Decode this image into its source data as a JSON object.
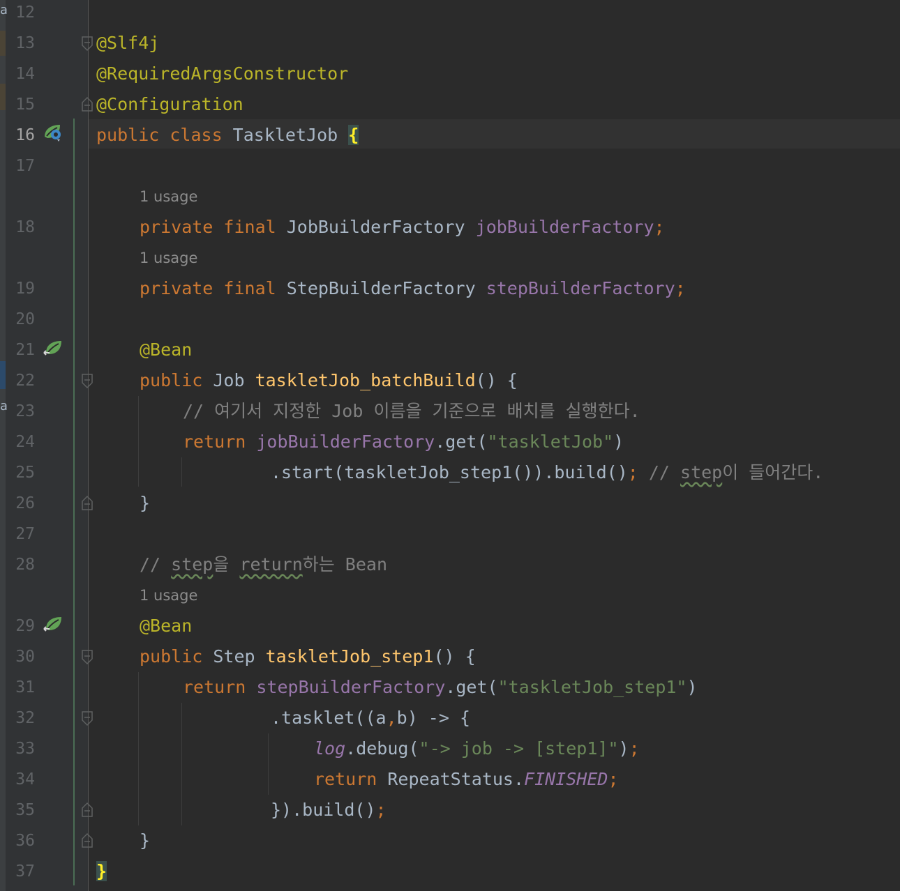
{
  "editor": {
    "line_numbers": [
      "12",
      "13",
      "14",
      "15",
      "16",
      "17",
      "18",
      "19",
      "20",
      "21",
      "22",
      "23",
      "24",
      "25",
      "26",
      "27",
      "28",
      "29",
      "30",
      "31",
      "32",
      "33",
      "34",
      "35",
      "36",
      "37"
    ],
    "usage_hint": "1 usage",
    "left_fragments": [
      "a",
      "a"
    ],
    "lines": {
      "l13": "@Slf4j",
      "l14": "@RequiredArgsConstructor",
      "l15": "@Configuration",
      "l16_kw": "public class ",
      "l16_name": "TaskletJob ",
      "l16_brace": "{",
      "l18_kw": "private final ",
      "l18_type": "JobBuilderFactory ",
      "l18_field": "jobBuilderFactory",
      "l18_semi": ";",
      "l19_kw": "private final ",
      "l19_type": "StepBuilderFactory ",
      "l19_field": "stepBuilderFactory",
      "l19_semi": ";",
      "l21": "@Bean",
      "l22_kw": "public ",
      "l22_type": "Job ",
      "l22_method": "taskletJob_batchBuild",
      "l22_rest": "() {",
      "l23": "// 여기서 지정한 Job 이름을 기준으로 배치를 실행한다.",
      "l24_kw": "return ",
      "l24_field": "jobBuilderFactory",
      "l24_call": ".get(",
      "l24_str": "\"taskletJob\"",
      "l24_close": ")",
      "l25_code": ".start(taskletJob_step1()).build()",
      "l25_semi": "; ",
      "l25_cmt_pre": "// ",
      "l25_cmt_wavy": "step",
      "l25_cmt_rest": "이 들어간다.",
      "l26": "}",
      "l28_pre": "// ",
      "l28_w1": "step",
      "l28_mid": "을 ",
      "l28_w2": "return",
      "l28_rest": "하는 Bean",
      "l29": "@Bean",
      "l30_kw": "public ",
      "l30_type": "Step ",
      "l30_method": "taskletJob_step1",
      "l30_rest": "() {",
      "l31_kw": "return ",
      "l31_field": "stepBuilderFactory",
      "l31_call": ".get(",
      "l31_str": "\"taskletJob_step1\"",
      "l31_close": ")",
      "l32_a": ".tasklet((a",
      "l32_comma": ",",
      "l32_b": "b) -> {",
      "l33_log": "log",
      "l33_call": ".debug(",
      "l33_str": "\"-> job -> [step1]\"",
      "l33_close": ")",
      "l33_semi": ";",
      "l34_kw": "return ",
      "l34_type": "RepeatStatus.",
      "l34_const": "FINISHED",
      "l34_semi": ";",
      "l35_code": "}).build()",
      "l35_semi": ";",
      "l36": "}",
      "l37": "}"
    }
  },
  "colors": {
    "background": "#2b2b2b",
    "gutter": "#313335",
    "keyword": "#cc7832",
    "annotation": "#bbb529",
    "field": "#9876aa",
    "method": "#ffc66d",
    "string": "#6a8759",
    "comment": "#808080",
    "text": "#a9b7c6"
  },
  "icons": {
    "line16": "spring-config-icon",
    "line21": "spring-bean-icon",
    "line29": "spring-bean-icon"
  }
}
